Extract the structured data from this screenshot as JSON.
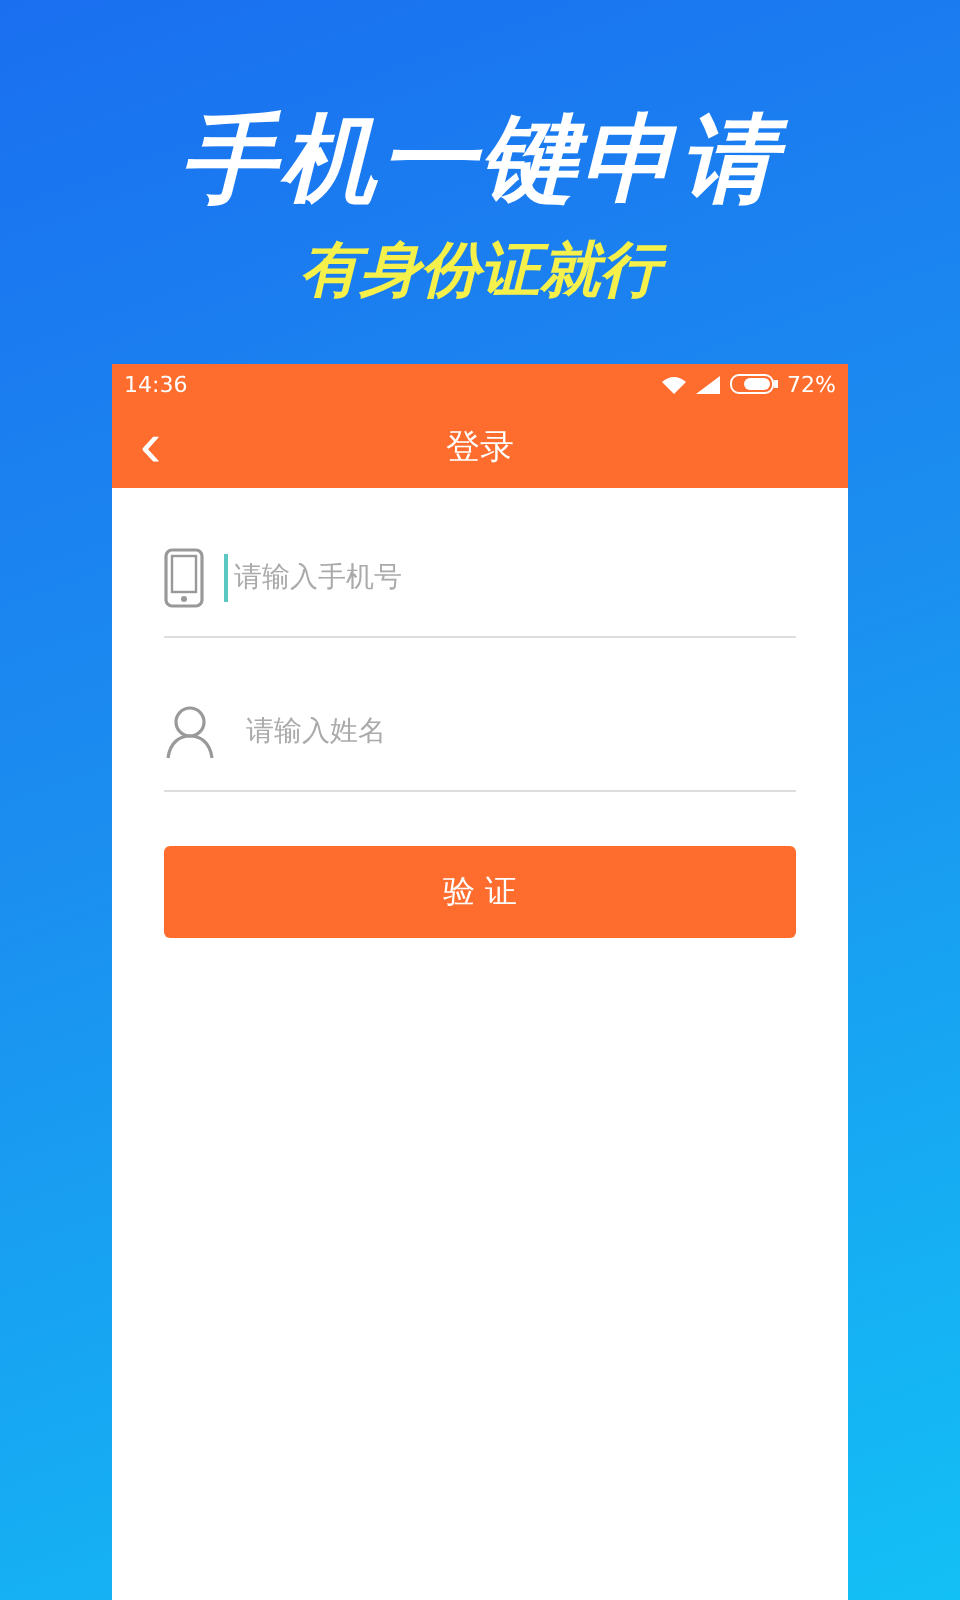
{
  "headline": "手机一键申请",
  "subheadline": "有身份证就行",
  "status_bar": {
    "time": "14:36",
    "battery": "72%"
  },
  "nav": {
    "back": "‹",
    "title": "登录"
  },
  "fields": [
    {
      "kind": "phone",
      "placeholder": "请输入手机号",
      "focused": true
    },
    {
      "kind": "person",
      "placeholder": "请输入姓名",
      "focused": false
    }
  ],
  "submit_button": "验 证"
}
